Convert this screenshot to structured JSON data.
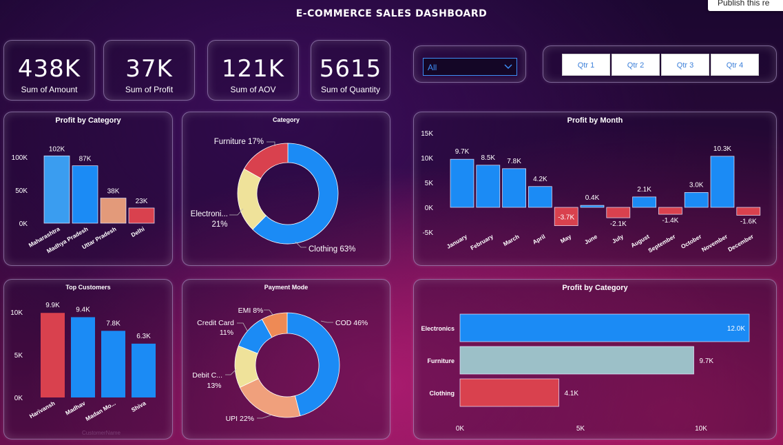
{
  "header": {
    "title": "E-COMMERCE  SALES  DASHBOARD",
    "publish_label": "Publish this re"
  },
  "kpis": [
    {
      "value": "438K",
      "label": "Sum of Amount"
    },
    {
      "value": "37K",
      "label": "Sum of Profit"
    },
    {
      "value": "121K",
      "label": "Sum of AOV"
    },
    {
      "value": "5615",
      "label": "Sum of Quantity"
    }
  ],
  "filters": {
    "state_select_value": "All",
    "quarters": [
      "Qtr 1",
      "Qtr 2",
      "Qtr 3",
      "Qtr 4"
    ]
  },
  "colors": {
    "blue": "#1b8bf5",
    "light_blue": "#3a9df0",
    "salmon": "#e39a7a",
    "red": "#d9414e",
    "yellow": "#efe29a",
    "orange": "#ee8a55",
    "peach": "#f0a07c",
    "teal": "#9cc0c8"
  },
  "chart_data": [
    {
      "type": "bar",
      "title": "Profit by Category",
      "categories": [
        "Maharashtra",
        "Madhya Pradesh",
        "Uttar Pradesh",
        "Delhi"
      ],
      "values": [
        102,
        87,
        38,
        23
      ],
      "data_labels": [
        "102K",
        "87K",
        "38K",
        "23K"
      ],
      "yticks": [
        "0K",
        "50K",
        "100K"
      ],
      "ylim": [
        0,
        120
      ],
      "colors": [
        "#3a9df0",
        "#1b8bf5",
        "#e39a7a",
        "#d9414e"
      ]
    },
    {
      "type": "pie",
      "title": "Category",
      "labels": [
        "Clothing",
        "Furniture",
        "Electronics"
      ],
      "values": [
        63,
        17,
        21
      ],
      "data_labels": [
        "Clothing 63%",
        "Furniture 17%",
        "Electroni...",
        "21%"
      ],
      "colors": [
        "#1b8bf5",
        "#d9414e",
        "#efe29a"
      ]
    },
    {
      "type": "bar",
      "title": "Profit by Month",
      "categories": [
        "January",
        "February",
        "March",
        "April",
        "May",
        "June",
        "July",
        "August",
        "September",
        "October",
        "November",
        "December"
      ],
      "values": [
        9.7,
        8.5,
        7.8,
        4.2,
        -3.7,
        0.4,
        -2.1,
        2.1,
        -1.4,
        3.0,
        10.3,
        -1.6
      ],
      "data_labels": [
        "9.7K",
        "8.5K",
        "7.8K",
        "4.2K",
        "-3.7K",
        "0.4K",
        "-2.1K",
        "2.1K",
        "-1.4K",
        "3.0K",
        "10.3K",
        "-1.6K"
      ],
      "yticks": [
        "-5K",
        "0K",
        "5K",
        "10K",
        "15K"
      ],
      "ylim": [
        -5,
        15
      ]
    },
    {
      "type": "bar",
      "title": "Top Customers",
      "categories": [
        "Harivansh",
        "Madhav",
        "Madan Mo...",
        "Shiva"
      ],
      "values": [
        9.9,
        9.4,
        7.8,
        6.3
      ],
      "data_labels": [
        "9.9K",
        "9.4K",
        "7.8K",
        "6.3K"
      ],
      "yticks": [
        "0K",
        "5K",
        "10K"
      ],
      "ylim": [
        0,
        11
      ],
      "xlabel": "CustomerName",
      "colors": [
        "#d9414e",
        "#1b8bf5",
        "#1b8bf5",
        "#1b8bf5"
      ]
    },
    {
      "type": "pie",
      "title": "Payment Mode",
      "labels": [
        "COD",
        "UPI",
        "Debit Card",
        "Credit Card",
        "EMI"
      ],
      "values": [
        46,
        22,
        13,
        11,
        8
      ],
      "data_labels": [
        "COD 46%",
        "UPI 22%",
        "Debit C...",
        "13%",
        "Credit Card",
        "11%",
        "EMI 8%"
      ],
      "colors": [
        "#1b8bf5",
        "#f0a07c",
        "#efe29a",
        "#1b8bf5",
        "#ee8a55"
      ]
    },
    {
      "type": "bar",
      "orientation": "horizontal",
      "title": "Profit by Category",
      "categories": [
        "Electronics",
        "Furniture",
        "Clothing"
      ],
      "values": [
        12.0,
        9.7,
        4.1
      ],
      "data_labels": [
        "12.0K",
        "9.7K",
        "4.1K"
      ],
      "xticks": [
        "0K",
        "5K",
        "10K"
      ],
      "xlim": [
        0,
        12.0
      ],
      "colors": [
        "#1b8bf5",
        "#9cc0c8",
        "#d9414e"
      ]
    }
  ]
}
